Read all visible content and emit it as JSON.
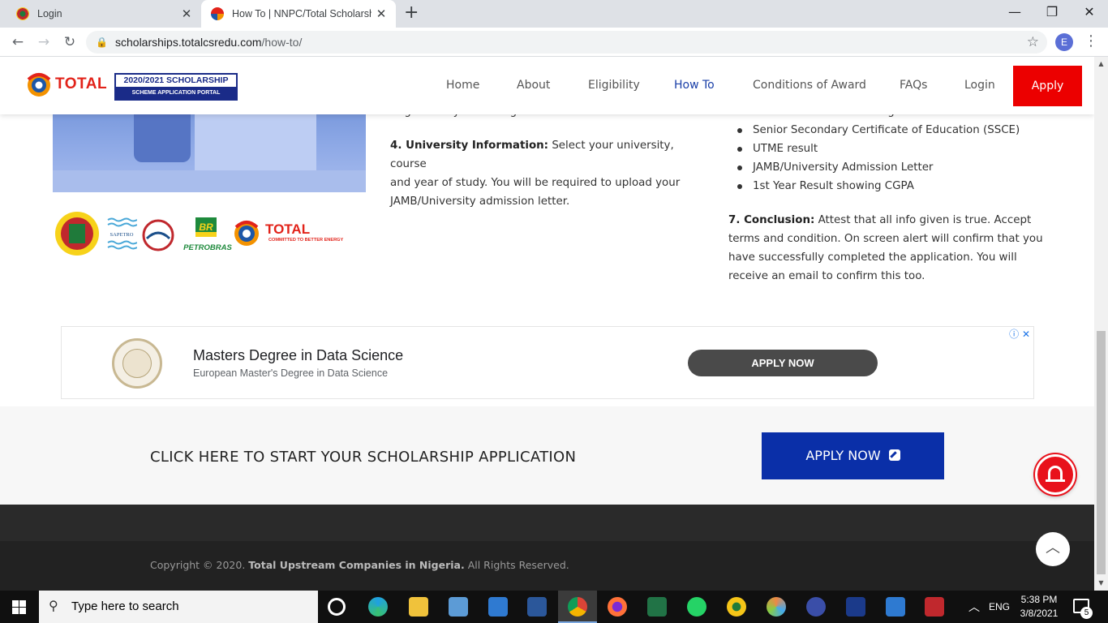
{
  "browser": {
    "tabs": [
      {
        "title": "Login",
        "active": false
      },
      {
        "title": "How To | NNPC/Total Scholarship",
        "active": true
      }
    ],
    "url_host": "scholarships.totalcsredu.com",
    "url_path": "/how-to/",
    "profile_initial": "E"
  },
  "site": {
    "brand": "TOTAL",
    "badge_line1": "2020/2021 SCHOLARSHIP",
    "badge_line2": "SCHEME APPLICATION PORTAL",
    "nav": [
      "Home",
      "About",
      "Eligibility",
      "How To",
      "Conditions of Award",
      "FAQs",
      "Login"
    ],
    "nav_active": "How To",
    "apply_label": "Apply"
  },
  "content": {
    "clipped_col2": "origin from your local government or State.",
    "step4_title": "4. University Information:",
    "step4_line1": "Select your university, course",
    "step4_line2": "and year of study. You will be required to upload your",
    "step4_line3": "JAMB/University admission letter.",
    "clipped_col3": "Certificate of Proof of Origin",
    "documents": [
      "Senior Secondary Certificate of Education (SSCE)",
      "UTME result",
      "JAMB/University Admission Letter",
      "1st Year Result showing CGPA"
    ],
    "step7_title": "7. Conclusion:",
    "step7_line1": "Attest that all info given is true. Accept",
    "step7_line2": "terms and condition. On screen alert will confirm that you",
    "step7_line3": "have successfully completed the application. You will",
    "step7_line4": "receive an email to confirm this too.",
    "sponsors": {
      "sapetro": "SAPETRO",
      "petrobras_mark": "BR",
      "petrobras": "PETROBRAS",
      "total": "TOTAL",
      "total_tagline": "COMMITTED TO BETTER ENERGY"
    }
  },
  "ad": {
    "headline": "Masters Degree in Data Science",
    "subline": "European Master's Degree in Data Science",
    "cta": "APPLY NOW",
    "adchoices": "ⓘ ✕"
  },
  "cta_band": {
    "text": "CLICK HERE TO START YOUR SCHOLARSHIP APPLICATION",
    "button": "APPLY NOW"
  },
  "footer": {
    "prefix": "Copyright © 2020. ",
    "company": "Total Upstream Companies in Nigeria.",
    "suffix": " All Rights Reserved."
  },
  "taskbar": {
    "search_placeholder": "Type here to search",
    "lang": "ENG",
    "time": "5:38 PM",
    "date": "3/8/2021",
    "notif_count": "5"
  },
  "colors": {
    "apply_red": "#ec0000",
    "nav_active": "#1a3fa8",
    "cta_blue": "#0a2fa8",
    "footer_dark": "#222222"
  }
}
